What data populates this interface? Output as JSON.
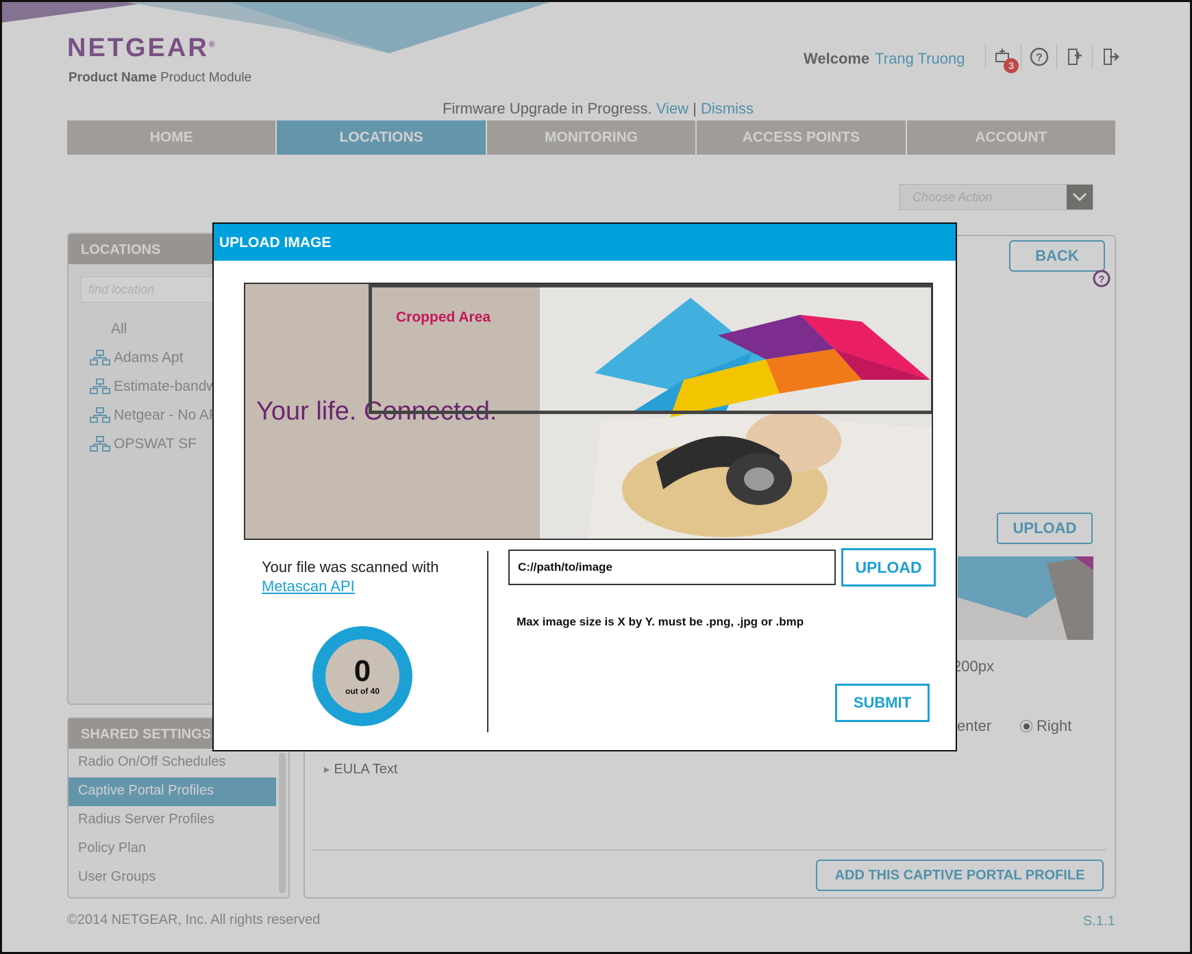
{
  "header": {
    "logo": "NETGEAR",
    "product_name": "Product Name",
    "product_module": "Product Module",
    "welcome_label": "Welcome",
    "user_name": "Trang Truong",
    "notification_count": "3"
  },
  "firmware": {
    "message": "Firmware Upgrade in Progress.",
    "view_link": "View",
    "separator": "|",
    "dismiss_link": "Dismiss"
  },
  "nav": {
    "tabs": [
      {
        "label": "HOME"
      },
      {
        "label": "LOCATIONS"
      },
      {
        "label": "MONITORING"
      },
      {
        "label": "ACCESS POINTS"
      },
      {
        "label": "ACCOUNT"
      }
    ],
    "active": "LOCATIONS"
  },
  "choose_action": {
    "placeholder": "Choose Action"
  },
  "locations": {
    "title": "LOCATIONS",
    "search_placeholder": "find location",
    "items": [
      {
        "label": "All"
      },
      {
        "label": "Adams Apt"
      },
      {
        "label": "Estimate-bandw"
      },
      {
        "label": "Netgear - No AP"
      },
      {
        "label": "OPSWAT SF"
      }
    ]
  },
  "shared_settings": {
    "title": "SHARED SETTINGS",
    "items": [
      {
        "label": "Radio On/Off Schedules"
      },
      {
        "label": "Captive Portal Profiles"
      },
      {
        "label": "Radius Server Profiles"
      },
      {
        "label": "Policy Plan"
      },
      {
        "label": "User Groups"
      }
    ]
  },
  "main": {
    "back_label": "BACK",
    "upload_label": "UPLOAD",
    "size_text": "200px",
    "align_center": "enter",
    "align_right": "Right",
    "eula_label": "EULA Text",
    "add_button": "ADD THIS CAPTIVE PORTAL PROFILE"
  },
  "footer": {
    "copyright": "©2014 NETGEAR, Inc. All rights reserved",
    "version": "S.1.1"
  },
  "modal": {
    "title": "UPLOAD IMAGE",
    "tagline": "Your life. Connected.",
    "crop_label": "Cropped Area",
    "scan_text": "Your file was scanned with",
    "scan_link": "Metascan API ",
    "gauge_value": "0",
    "gauge_sub": "out of 40",
    "path_value": "C://path/to/image",
    "upload_label": "UPLOAD",
    "max_size": "Max image size is X by Y. must be .png, .jpg or .bmp",
    "submit_label": "SUBMIT"
  },
  "colors": {
    "accent_blue": "#00a0dc",
    "brand_purple": "#7a3c8c",
    "nav_active": "#5aa6c7",
    "nav_inactive": "#b6b1ab",
    "crop_label": "#c2185b",
    "badge_red": "#e4312b"
  }
}
